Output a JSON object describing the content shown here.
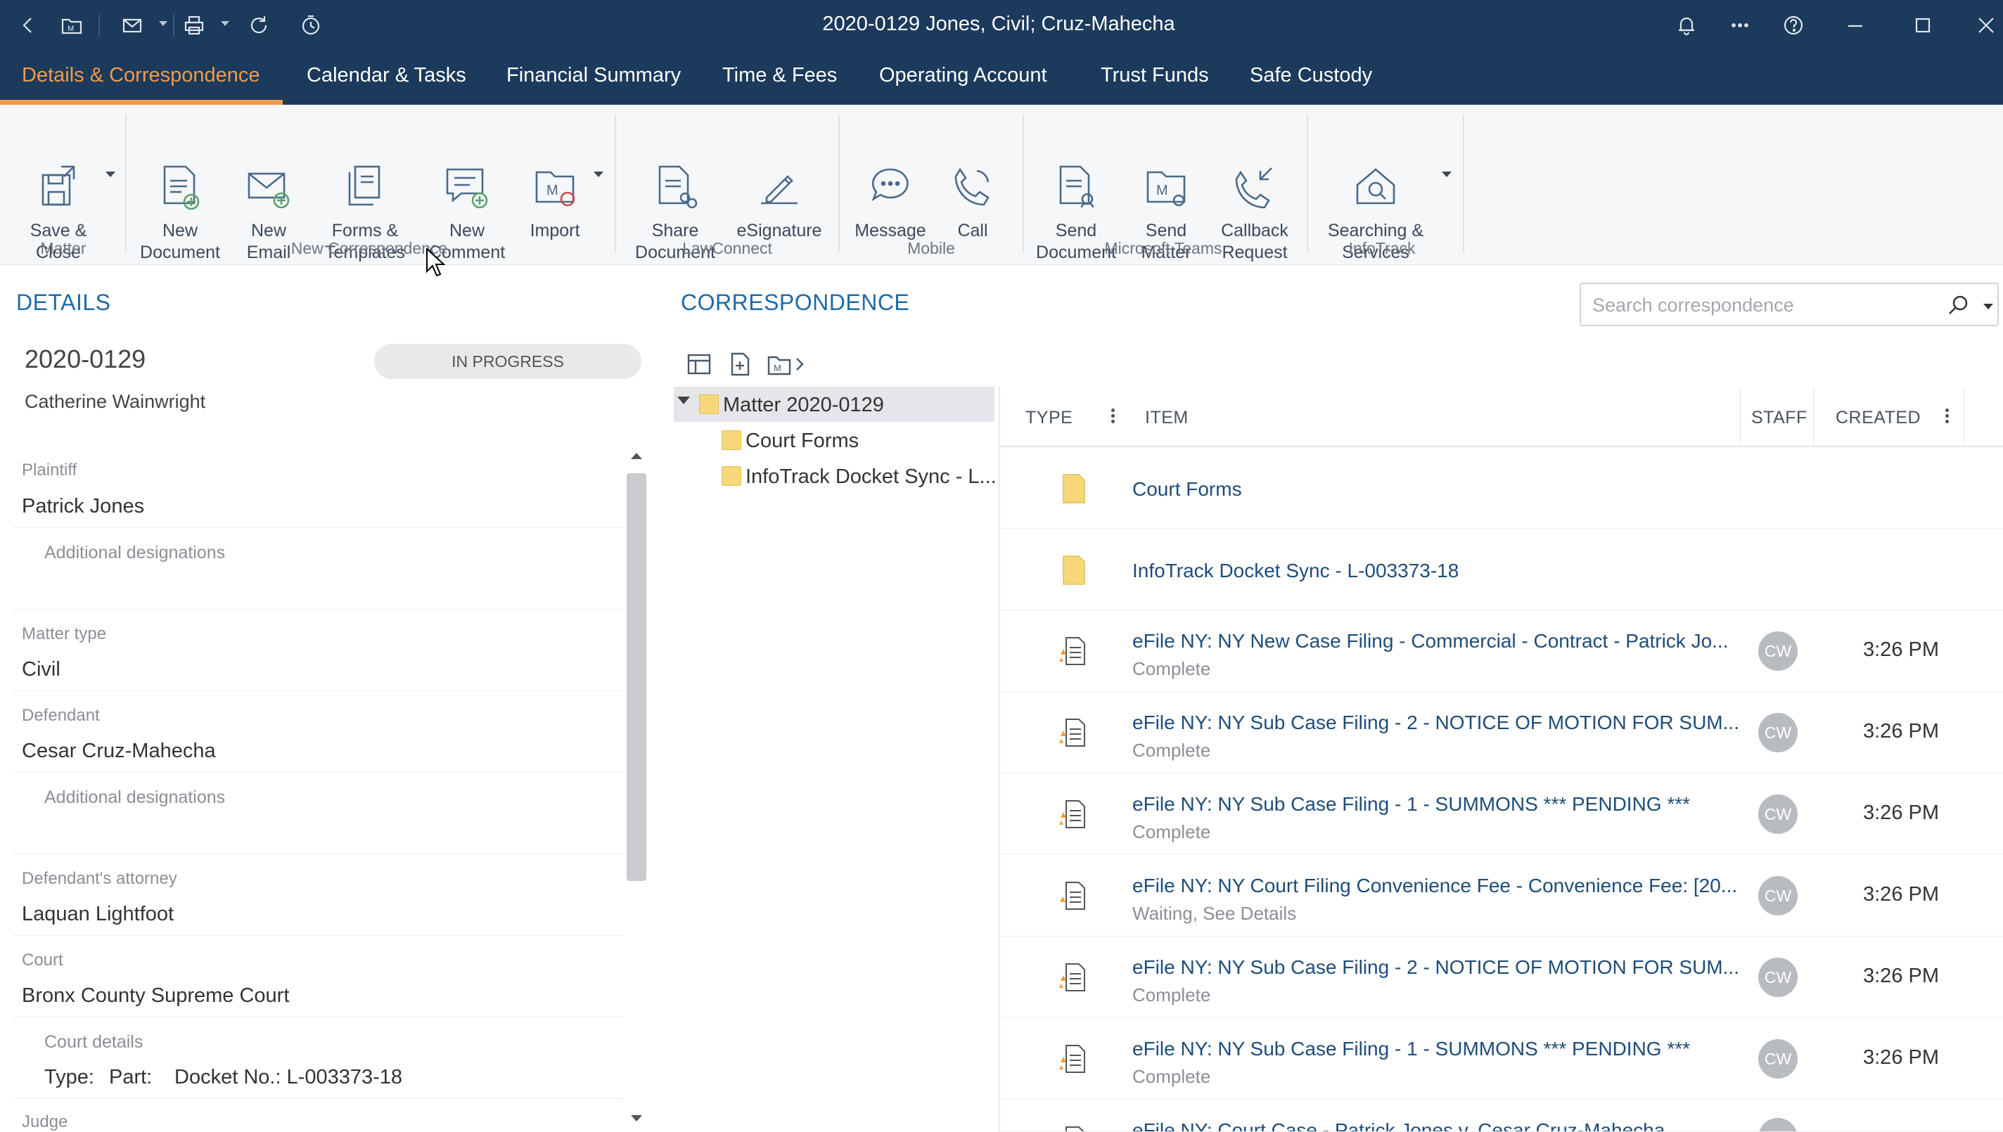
{
  "window": {
    "title": "2020-0129 Jones, Civil; Cruz-Mahecha"
  },
  "titlebar_icons": [
    "back-icon",
    "matter-icon",
    "mail-icon",
    "print-icon",
    "refresh-icon",
    "timer-icon",
    "bell-icon",
    "more-icon",
    "help-icon",
    "minimize-icon",
    "maximize-icon",
    "close-icon"
  ],
  "tabs": [
    {
      "label": "Details & Correspondence",
      "active": true
    },
    {
      "label": "Calendar & Tasks"
    },
    {
      "label": "Financial Summary"
    },
    {
      "label": "Time & Fees"
    },
    {
      "label": "Operating Account"
    },
    {
      "label": "Trust Funds"
    },
    {
      "label": "Safe Custody"
    }
  ],
  "ribbon": {
    "buttons": {
      "save_close": "Save &\nClose",
      "new_document": "New\nDocument",
      "new_email": "New\nEmail",
      "forms_templates": "Forms &\nTemplates",
      "new_comment": "New\nComment",
      "import": "Import",
      "share_document": "Share\nDocument",
      "esignature": "eSignature",
      "message": "Message",
      "call": "Call",
      "send_document": "Send\nDocument",
      "send_matter": "Send\nMatter",
      "callback_request": "Callback\nRequest",
      "searching_services": "Searching &\nServices"
    },
    "groups": {
      "matter": "Matter",
      "new_correspondence": "New Correspondence",
      "lawconnect": "LawConnect",
      "mobile": "Mobile",
      "microsoft_teams": "Microsoft Teams",
      "infotrack": "InfoTrack"
    }
  },
  "details": {
    "section_title": "DETAILS",
    "matter_number": "2020-0129",
    "client": "Catherine Wainwright",
    "status": "IN PROGRESS",
    "fields": {
      "plaintiff_label": "Plaintiff",
      "plaintiff_value": "Patrick Jones",
      "plaintiff_designations": "Additional designations",
      "matter_type_label": "Matter type",
      "matter_type_value": "Civil",
      "defendant_label": "Defendant",
      "defendant_value": "Cesar Cruz-Mahecha",
      "defendant_designations": "Additional designations",
      "defendant_attorney_label": "Defendant's attorney",
      "defendant_attorney_value": "Laquan Lightfoot",
      "court_label": "Court",
      "court_value": "Bronx County Supreme Court",
      "court_details_label": "Court details",
      "court_type": "Type:",
      "court_part": "Part:",
      "court_docket": "Docket No.: L-003373-18",
      "judge_label": "Judge"
    }
  },
  "correspondence": {
    "section_title": "CORRESPONDENCE",
    "search_placeholder": "Search correspondence",
    "tree": [
      {
        "label": "Matter 2020-0129",
        "selected": true
      },
      {
        "label": "Court Forms"
      },
      {
        "label": "InfoTrack Docket Sync - L..."
      }
    ],
    "columns": {
      "type": "TYPE",
      "item": "ITEM",
      "staff": "STAFF",
      "created": "CREATED"
    },
    "rows": [
      {
        "kind": "folder",
        "title": "Court Forms"
      },
      {
        "kind": "folder",
        "title": "InfoTrack Docket Sync - L-003373-18"
      },
      {
        "kind": "efile",
        "title": "eFile NY: NY New Case Filing - Commercial - Contract - Patrick Jo...",
        "status": "Complete",
        "staff": "CW",
        "created": "3:26 PM"
      },
      {
        "kind": "efile",
        "title": "eFile NY: NY Sub Case Filing - 2 - NOTICE OF MOTION FOR SUM...",
        "status": "Complete",
        "staff": "CW",
        "created": "3:26 PM"
      },
      {
        "kind": "efile",
        "title": "eFile NY: NY Sub Case Filing - 1 - SUMMONS *** PENDING ***",
        "status": "Complete",
        "staff": "CW",
        "created": "3:26 PM"
      },
      {
        "kind": "efile-waiting",
        "title": "eFile NY: NY Court Filing Convenience Fee - Convenience Fee: [20...",
        "status": "Waiting, See Details",
        "staff": "CW",
        "created": "3:26 PM"
      },
      {
        "kind": "efile",
        "title": "eFile NY: NY Sub Case Filing - 2 - NOTICE OF MOTION FOR SUM...",
        "status": "Complete",
        "staff": "CW",
        "created": "3:26 PM"
      },
      {
        "kind": "efile",
        "title": "eFile NY: NY Sub Case Filing - 1 - SUMMONS *** PENDING ***",
        "status": "Complete",
        "staff": "CW",
        "created": "3:26 PM"
      },
      {
        "kind": "efile",
        "title": "eFile NY: Court Case - Patrick Jones v. Cesar Cruz-Mahecha",
        "status": "",
        "staff": "",
        "created": ""
      }
    ]
  },
  "colors": {
    "header_bg": "#1b3a5c",
    "accent": "#f19a4a",
    "link": "#1e4d7a",
    "section_title": "#1f6aa8"
  }
}
